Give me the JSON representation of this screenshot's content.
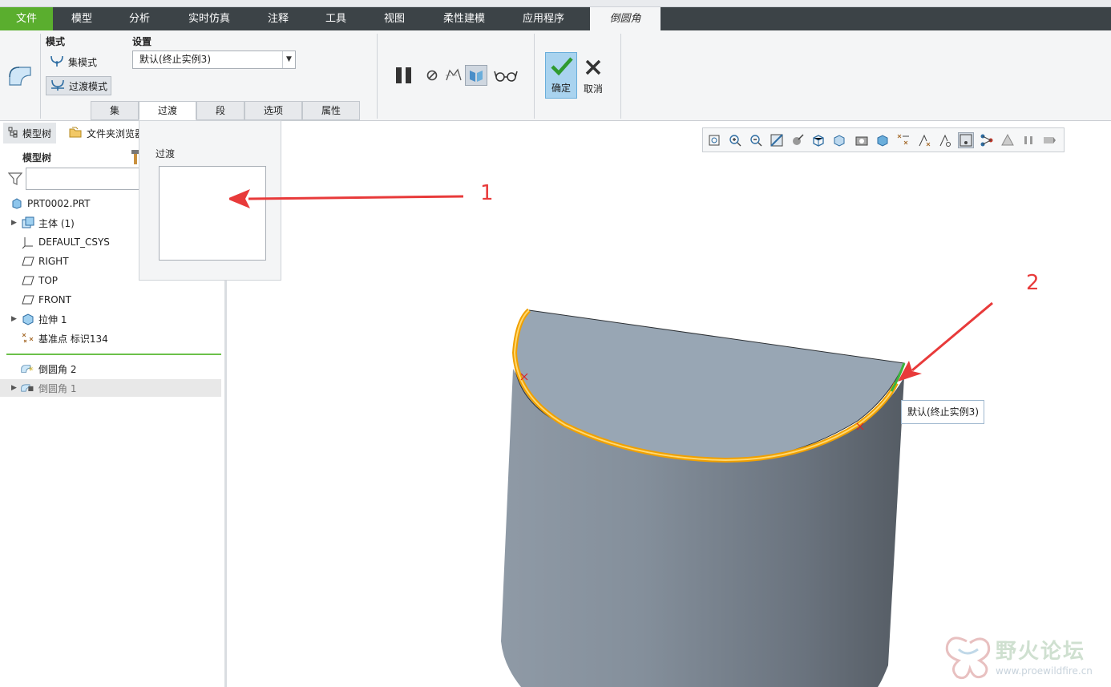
{
  "menu": {
    "tabs": [
      {
        "label": "文件"
      },
      {
        "label": "模型"
      },
      {
        "label": "分析"
      },
      {
        "label": "实时仿真"
      },
      {
        "label": "注释"
      },
      {
        "label": "工具"
      },
      {
        "label": "视图"
      },
      {
        "label": "柔性建模"
      },
      {
        "label": "应用程序"
      },
      {
        "label": "倒圆角"
      }
    ]
  },
  "ribbon": {
    "mode_label": "模式",
    "set_mode": "集模式",
    "transition_mode": "过渡模式",
    "settings_label": "设置",
    "settings_value": "默认(终止实例3)",
    "subtabs": [
      "集",
      "过渡",
      "段",
      "选项",
      "属性"
    ],
    "ok_label": "确定",
    "cancel_label": "取消"
  },
  "left_panel": {
    "tab_model_tree": "模型树",
    "tab_folder_browser": "文件夹浏览器",
    "tree_title": "模型树",
    "tree": [
      {
        "label": "PRT0002.PRT",
        "icon": "part-icon",
        "expandable": false
      },
      {
        "label": "主体 (1)",
        "icon": "body-icon",
        "expandable": true
      },
      {
        "label": "DEFAULT_CSYS",
        "icon": "csys-icon",
        "expandable": false
      },
      {
        "label": "RIGHT",
        "icon": "datum-plane-icon",
        "expandable": false
      },
      {
        "label": "TOP",
        "icon": "datum-plane-icon",
        "expandable": false
      },
      {
        "label": "FRONT",
        "icon": "datum-plane-icon",
        "expandable": false
      },
      {
        "label": "拉伸 1",
        "icon": "extrude-icon",
        "expandable": true
      },
      {
        "label": "基准点 标识134",
        "icon": "datum-point-icon",
        "expandable": false
      },
      {
        "label": "倒圆角 2",
        "icon": "round-icon",
        "expandable": false
      },
      {
        "label": "倒圆角 1",
        "icon": "round-icon",
        "expandable": true
      }
    ]
  },
  "transition_panel": {
    "title": "过渡"
  },
  "viewport": {
    "tooltip": "默认(终止实例3)",
    "annotation_1": "1",
    "annotation_2": "2"
  },
  "watermark": {
    "name": "野火论坛",
    "url": "www.proewildfire.cn"
  },
  "colors": {
    "file_tab": "#5aae2e",
    "menubar": "#3c4347",
    "highlight_edge": "#f0a000",
    "annotation": "#e83a3a"
  }
}
